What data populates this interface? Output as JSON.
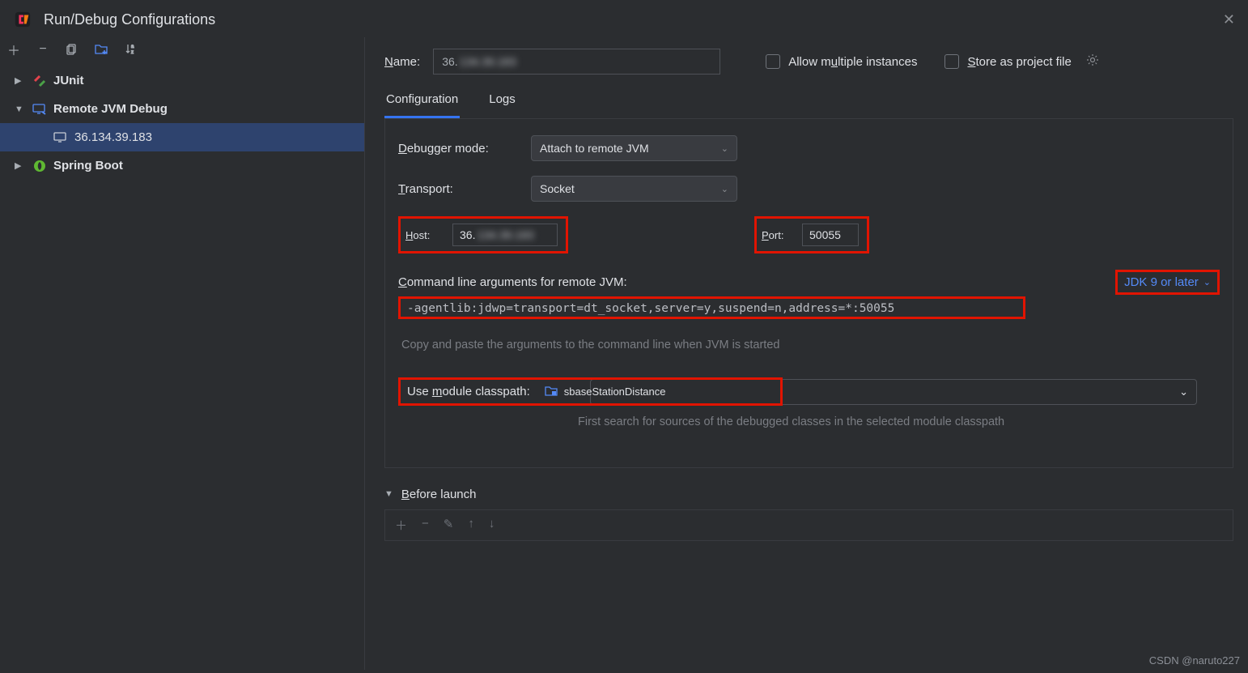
{
  "title": "Run/Debug Configurations",
  "sidebar": {
    "junit": "JUnit",
    "remote": "Remote JVM Debug",
    "remote_child": "36.134.39.183",
    "spring": "Spring Boot"
  },
  "toprow": {
    "name_label": "Name:",
    "name_value": "36.",
    "allow_multiple": "Allow multiple instances",
    "store_as_project": "Store as project file"
  },
  "tabs": {
    "configuration": "Configuration",
    "logs": "Logs"
  },
  "form": {
    "debugger_mode_label": "Debugger mode:",
    "debugger_mode_value": "Attach to remote JVM",
    "transport_label": "Transport:",
    "transport_value": "Socket",
    "host_label": "Host:",
    "host_value": "36.",
    "port_label": "Port:",
    "port_value": "50055",
    "cmdline_label": "Command line arguments for remote JVM:",
    "jdk_label": "JDK 9 or later",
    "cmdline_value": "-agentlib:jdwp=transport=dt_socket,server=y,suspend=n,address=*:50055",
    "copy_hint": "Copy and paste the arguments to the command line when JVM is started",
    "module_label": "Use module classpath:",
    "module_value": "sbaseStationDistance",
    "module_hint": "First search for sources of the debugged classes in the selected module classpath",
    "before_launch": "Before launch"
  },
  "watermark": "CSDN @naruto227"
}
